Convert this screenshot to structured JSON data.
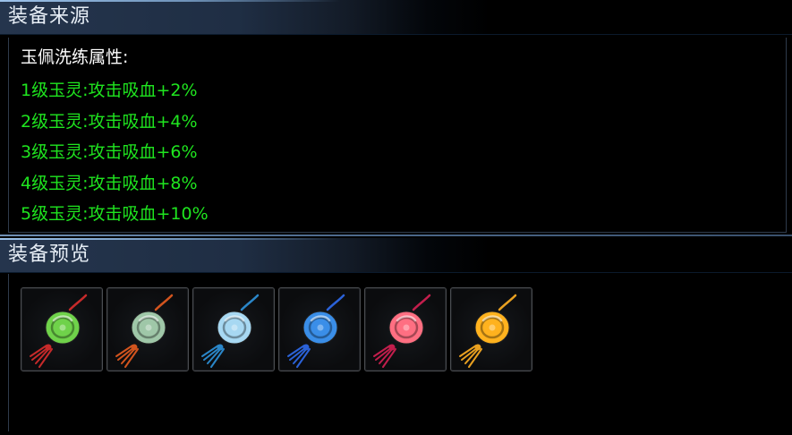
{
  "source_section": {
    "title": "装备来源",
    "heading": "玉佩洗练属性:",
    "attributes": [
      "1级玉灵:攻击吸血+2%",
      "2级玉灵:攻击吸血+4%",
      "3级玉灵:攻击吸血+6%",
      "4级玉灵:攻击吸血+8%",
      "5级玉灵:攻击吸血+10%"
    ],
    "attribute_color": "#1fe51f"
  },
  "preview_section": {
    "title": "装备预览",
    "items": [
      {
        "icon": "green-jade-pendant-icon",
        "body_color": "#6fd24a",
        "tassel_color": "#c62a2a"
      },
      {
        "icon": "celadon-dragon-pendant-icon",
        "body_color": "#9fc7a8",
        "tassel_color": "#d2541e"
      },
      {
        "icon": "light-blue-cloud-pendant-icon",
        "body_color": "#a7d8f2",
        "tassel_color": "#2a86c8"
      },
      {
        "icon": "blue-cloud-pendant-icon",
        "body_color": "#3a8ee8",
        "tassel_color": "#2b62d8"
      },
      {
        "icon": "red-jade-pendant-icon",
        "body_color": "#ff6f82",
        "tassel_color": "#c21e4c"
      },
      {
        "icon": "gold-jade-pendant-icon",
        "body_color": "#ffb21e",
        "tassel_color": "#e8a020"
      }
    ]
  }
}
